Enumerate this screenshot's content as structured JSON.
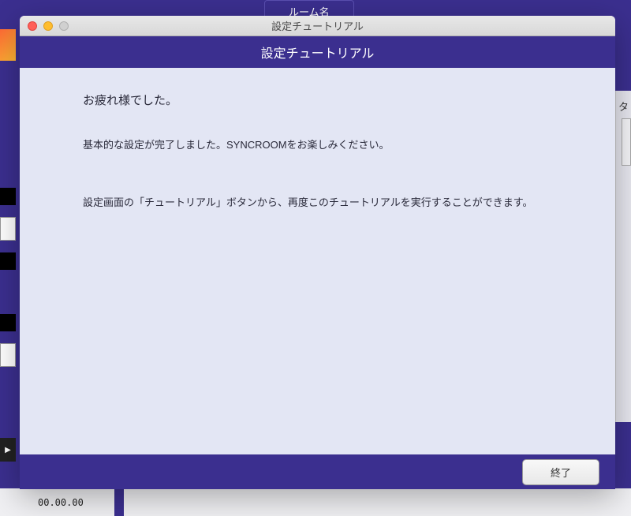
{
  "background": {
    "tab_label": "ルーム名",
    "right_label": "タ",
    "timecode": "00.00.00",
    "play_icon": "▶"
  },
  "window": {
    "titlebar_title": "設定チュートリアル",
    "header_title": "設定チュートリアル",
    "content": {
      "heading": "お疲れ様でした。",
      "text1": "基本的な設定が完了しました。SYNCROOMをお楽しみください。",
      "text2": "設定画面の「チュートリアル」ボタンから、再度このチュートリアルを実行することができます。"
    },
    "footer": {
      "finish_label": "終了"
    }
  }
}
